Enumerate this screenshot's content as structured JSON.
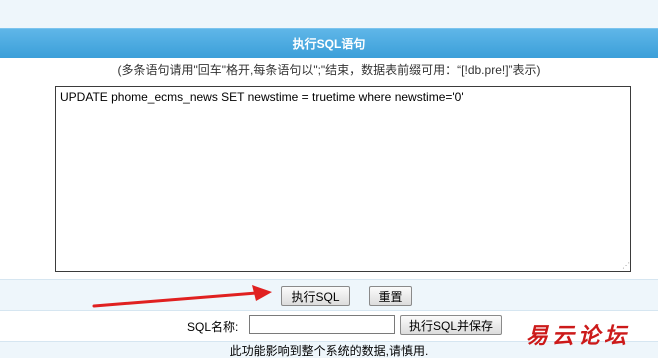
{
  "header": {
    "title": "执行SQL语句"
  },
  "hint": {
    "text": "(多条语句请用\"回车\"格开,每条语句以\";\"结束，数据表前缀可用：“[!db.pre!]”表示)"
  },
  "editor": {
    "value": "UPDATE phome_ecms_news SET newstime = truetime where newstime='0'"
  },
  "buttons": {
    "execute": "执行SQL",
    "reset": "重置",
    "execute_save": "执行SQL并保存"
  },
  "sql_name": {
    "label": "SQL名称:",
    "value": ""
  },
  "footer": {
    "warning": "此功能影响到整个系统的数据,请慎用."
  },
  "watermark": {
    "text": "易云论坛"
  },
  "colors": {
    "header": "#3b9fd9",
    "arrow": "#e02020",
    "watermark": "#cc1a1a"
  }
}
